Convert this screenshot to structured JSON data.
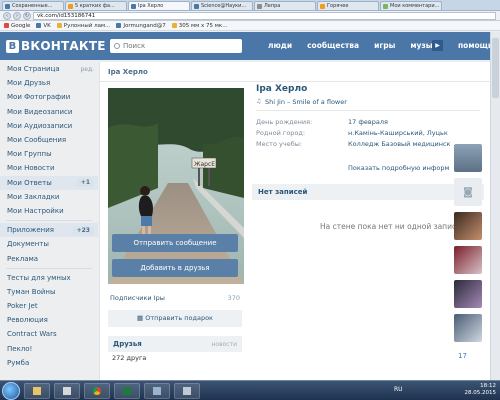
{
  "browser": {
    "tabs": [
      {
        "label": "Сохраненные...",
        "active": false
      },
      {
        "label": "5 кратких фа...",
        "active": false
      },
      {
        "label": "Іра Херло",
        "active": true
      },
      {
        "label": "Science@Науки...",
        "active": false
      },
      {
        "label": "Лепра",
        "active": false
      },
      {
        "label": "Горячее",
        "active": false
      },
      {
        "label": "Мои комментари...",
        "active": false
      }
    ],
    "url": "vk.com/id153186741",
    "bookmarks": [
      "Google",
      "VK",
      "Рулонный лам...",
      "Jormungand@7",
      "305 мм х 75 мк..."
    ]
  },
  "vk": {
    "logo": "ВКОНТАКТЕ",
    "search_placeholder": "Поиск",
    "top_nav": [
      "люди",
      "сообщества",
      "игры",
      "музыка"
    ],
    "top_nav_more": "помощь",
    "left_menu": [
      {
        "label": "Моя Страница",
        "extra": "ред."
      },
      {
        "label": "Мои Друзья"
      },
      {
        "label": "Мои Фотографии"
      },
      {
        "label": "Мои Видеозаписи"
      },
      {
        "label": "Мои Аудиозаписи"
      },
      {
        "label": "Мои Сообщения"
      },
      {
        "label": "Мои Группы"
      },
      {
        "label": "Мои Новости"
      },
      {
        "label": "Мои Ответы",
        "badge": "+1"
      },
      {
        "label": "Мои Закладки"
      },
      {
        "label": "Мои Настройки"
      }
    ],
    "left_menu2": [
      {
        "label": "Приложения",
        "badge": "+23"
      },
      {
        "label": "Документы"
      },
      {
        "label": "Реклама"
      }
    ],
    "left_apps": [
      "Тесты для умных",
      "Туман Войны",
      "Poker Jet",
      "Революция",
      "Contract Wars",
      "Пекло!",
      "Румба"
    ],
    "profile": {
      "breadcrumb": "Іра Херло",
      "name": "Іра Херло",
      "status": "Shi Jin – Smile of a flower",
      "info": [
        {
          "key": "День рождения:",
          "value": "17 февраля"
        },
        {
          "key": "Родной город:",
          "value": "н.Камінь-Каширський, Луцьк"
        },
        {
          "key": "Место учебы:",
          "value": "Колледж Базовый медицинск"
        }
      ],
      "more_link": "Показать подробную информ",
      "send_message": "Отправить сообщение",
      "add_friend": "Добавить в друзья",
      "subscribers_label": "Подписчики Іры",
      "subscribers_count": "370",
      "gift_button": "Отправить подарок",
      "friends_title": "Друзья",
      "friends_news": "новости",
      "friends_count": "272 друга",
      "wall_title": "Нет записей",
      "wall_empty": "На стене пока нет ни одной запис"
    },
    "right_strip_count": "17"
  },
  "taskbar": {
    "lang": "RU",
    "time": "18:12",
    "date": "28.05.2015"
  }
}
